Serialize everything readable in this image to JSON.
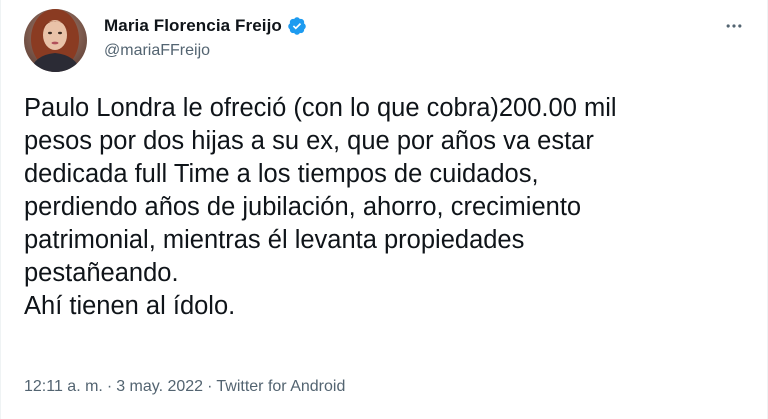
{
  "tweet": {
    "author": {
      "display_name": "Maria Florencia Freijo",
      "handle": "@mariaFFreijo",
      "verified": true,
      "avatar_icon": "profile-photo"
    },
    "text": "Paulo Londra le ofreció (con lo que cobra)200.00 mil\npesos por dos hijas a su ex, que por años va estar\ndedicada full Time a los tiempos de cuidados,\nperdiendo años de jubilación, ahorro, crecimiento\npatrimonial, mientras él levanta propiedades\npestañeando.\nAhí tienen al ídolo.",
    "time": "12:11 a. m.",
    "separator": "·",
    "date": "3 may. 2022",
    "separator2": "·",
    "source": "Twitter for Android",
    "more_icon": "more-options-icon"
  },
  "colors": {
    "verified_blue": "#1d9bf0",
    "secondary_text": "#536471",
    "primary_text": "#0f1419"
  }
}
